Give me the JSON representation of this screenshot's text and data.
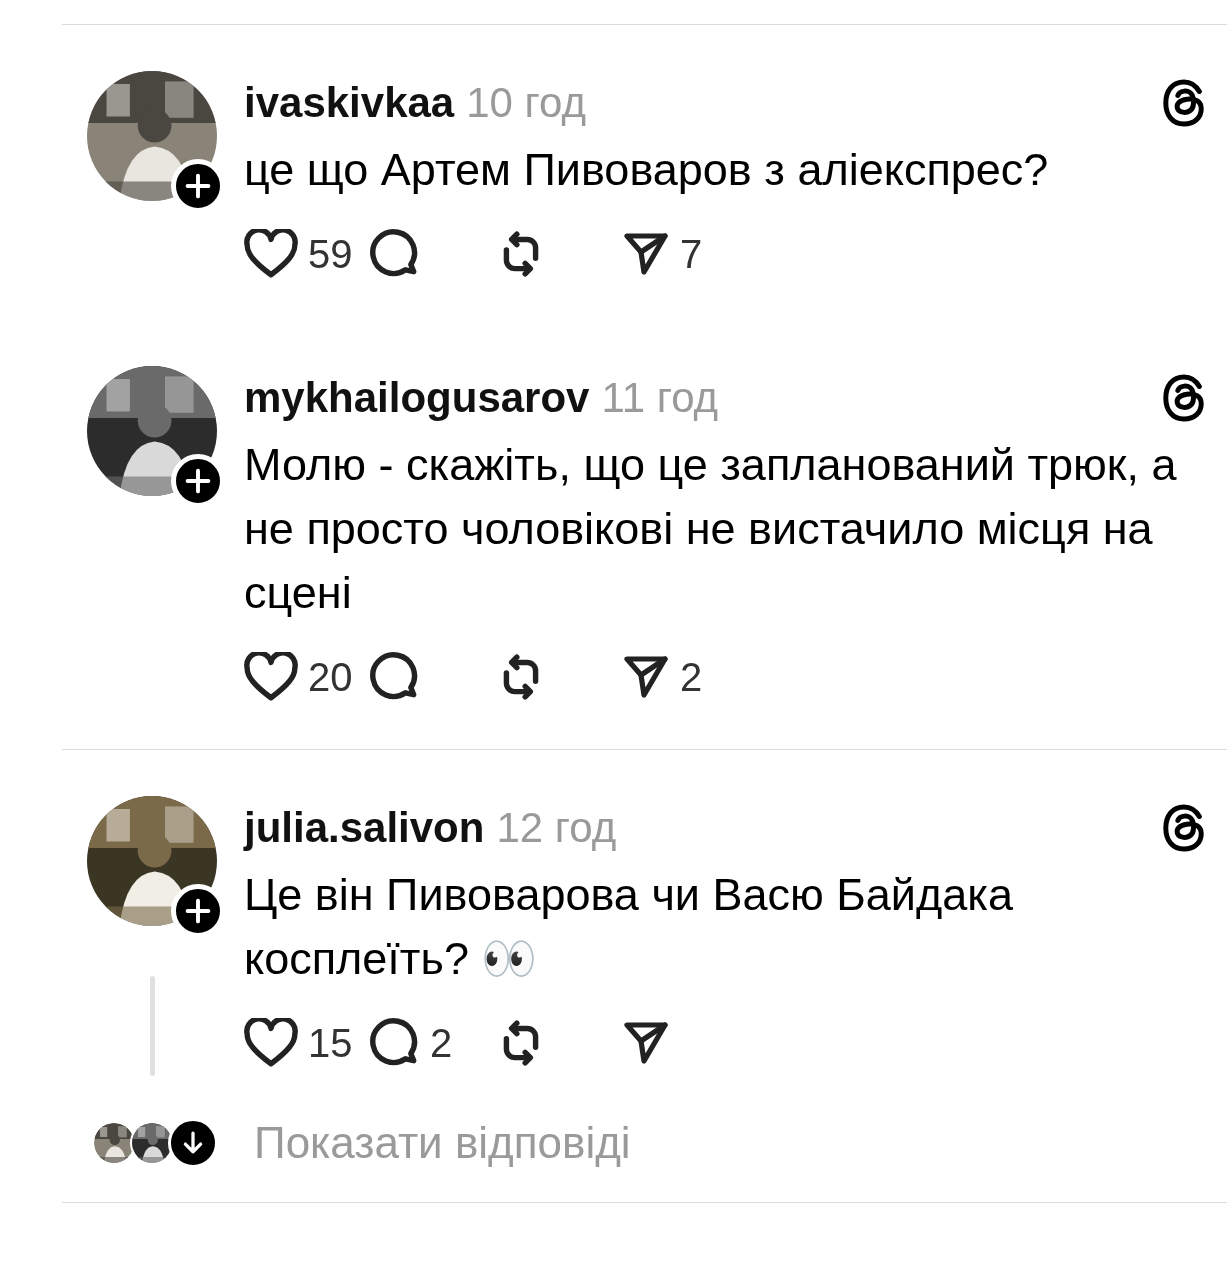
{
  "posts": [
    {
      "username": "ivaskivkaa",
      "time": "10 год",
      "text": "це що Артем Пивоваров з аліекспрес?",
      "likes": "59",
      "shares": "7",
      "thread_line": false,
      "divider_after": false
    },
    {
      "username": "mykhailogusarov",
      "time": "11 год",
      "text": "Молю - скажіть, що це запланований трюк, а не просто чоловікові не вистачило місця на сцені",
      "likes": "20",
      "shares": "2",
      "thread_line": false,
      "divider_after": true
    },
    {
      "username": "julia.salivon",
      "time": "12 год",
      "text": "Це він Пивоварова чи Васю Байдака косплеїть? 👀",
      "likes": "15",
      "replies": "2",
      "thread_line": true,
      "divider_after": false
    }
  ],
  "show_replies": {
    "label": "Показати відповіді"
  }
}
